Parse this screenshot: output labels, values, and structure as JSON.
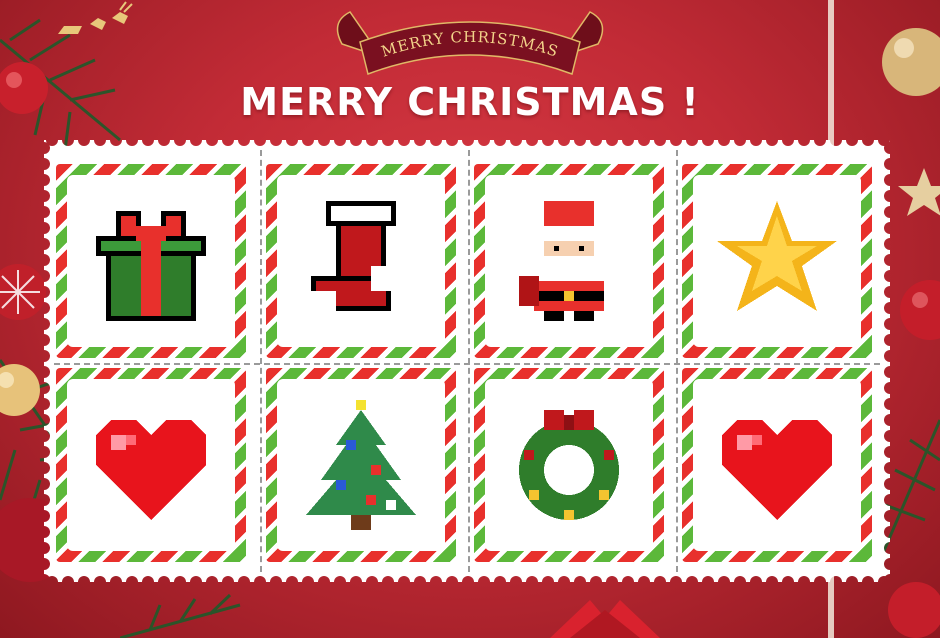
{
  "banner": {
    "text": "MERRY CHRISTMAS"
  },
  "title": "MERRY CHRISTMAS !",
  "colors": {
    "background": "#c22b36",
    "stripe_red": "#e8302c",
    "stripe_green": "#5cb83a",
    "banner_ribbon": "#7a1020",
    "banner_text": "#f3d48a"
  },
  "cards": [
    {
      "icon": "gift-icon",
      "row": 1,
      "col": 1
    },
    {
      "icon": "christmas-stocking-icon",
      "row": 1,
      "col": 2
    },
    {
      "icon": "santa-claus-icon",
      "row": 1,
      "col": 3
    },
    {
      "icon": "star-icon",
      "row": 1,
      "col": 4
    },
    {
      "icon": "heart-icon",
      "row": 2,
      "col": 1
    },
    {
      "icon": "christmas-tree-icon",
      "row": 2,
      "col": 2
    },
    {
      "icon": "wreath-icon",
      "row": 2,
      "col": 3
    },
    {
      "icon": "heart-icon",
      "row": 2,
      "col": 4
    }
  ]
}
